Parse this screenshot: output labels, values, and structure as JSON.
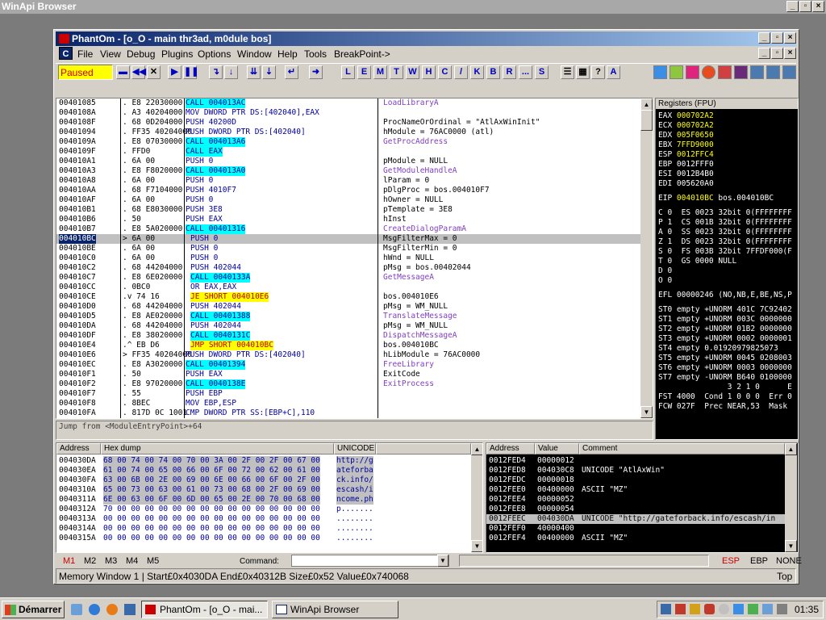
{
  "outer_title": "WinApi Browser",
  "window_title": "PhantOm - [o_O - main thr3ad, m0dule bos]",
  "menu": [
    "File",
    "View",
    "Debug",
    "Plugins",
    "Options",
    "Window",
    "Help",
    "Tools",
    "BreakPoint->"
  ],
  "menu_c": "C",
  "status_paused": "Paused",
  "tool_letters": [
    "L",
    "E",
    "M",
    "T",
    "W",
    "H",
    "C",
    "/",
    "K",
    "B",
    "R",
    "...",
    "S"
  ],
  "tool_help": "?",
  "disasm": [
    [
      "00401085",
      ". E8 22030000",
      "CALL 004013AC",
      "LoadLibraryA"
    ],
    [
      "0040108A",
      ". A3 40204000",
      "MOV DWORD PTR DS:[402040],EAX",
      ""
    ],
    [
      "0040108F",
      ". 68 0D204000",
      "PUSH 40200D",
      "ProcNameOrOrdinal = \"AtlAxWinInit\""
    ],
    [
      "00401094",
      ". FF35 40204000",
      "PUSH DWORD PTR DS:[402040]",
      "hModule = 76AC0000 (atl)"
    ],
    [
      "0040109A",
      ". E8 07030000",
      "CALL 004013A6",
      "GetProcAddress"
    ],
    [
      "0040109F",
      ". FFD0",
      "CALL EAX",
      ""
    ],
    [
      "004010A1",
      ". 6A 00",
      "PUSH 0",
      "pModule = NULL"
    ],
    [
      "004010A3",
      ". E8 F8020000",
      "CALL 004013A0",
      "GetModuleHandleA"
    ],
    [
      "004010A8",
      ". 6A 00",
      "PUSH 0",
      "lParam = 0"
    ],
    [
      "004010AA",
      ". 68 F7104000",
      "PUSH 4010F7",
      "pDlgProc = bos.004010F7"
    ],
    [
      "004010AF",
      ". 6A 00",
      "PUSH 0",
      "hOwner = NULL"
    ],
    [
      "004010B1",
      ". 68 E8030000",
      "PUSH 3E8",
      "pTemplate = 3E8"
    ],
    [
      "004010B6",
      ". 50",
      "PUSH EAX",
      "hInst"
    ],
    [
      "004010B7",
      ". E8 5A020000",
      "CALL 00401316",
      "CreateDialogParamA"
    ],
    [
      "004010BC",
      "> 6A 00",
      "PUSH 0",
      "MsgFilterMax = 0"
    ],
    [
      "004010BE",
      ". 6A 00",
      "PUSH 0",
      "MsgFilterMin = 0"
    ],
    [
      "004010C0",
      ". 6A 00",
      "PUSH 0",
      "hWnd = NULL"
    ],
    [
      "004010C2",
      ". 68 44204000",
      "PUSH 402044",
      "pMsg = bos.00402044"
    ],
    [
      "004010C7",
      ". E8 6E020000",
      "CALL 0040133A",
      "GetMessageA"
    ],
    [
      "004010CC",
      ". 0BC0",
      "OR EAX,EAX",
      ""
    ],
    [
      "004010CE",
      ".v 74 16",
      "JE SHORT 004010E6",
      "bos.004010E6"
    ],
    [
      "004010D0",
      ". 68 44204000",
      "PUSH 402044",
      "pMsg = WM_NULL"
    ],
    [
      "004010D5",
      ". E8 AE020000",
      "CALL 00401388",
      "TranslateMessage"
    ],
    [
      "004010DA",
      ". 68 44204000",
      "PUSH 402044",
      "pMsg = WM_NULL"
    ],
    [
      "004010DF",
      ". E8 38020000",
      "CALL 0040131C",
      "DispatchMessageA"
    ],
    [
      "004010E4",
      ".^ EB D6",
      "JMP SHORT 004010BC",
      "bos.004010BC"
    ],
    [
      "004010E6",
      "> FF35 40204000",
      "PUSH DWORD PTR DS:[402040]",
      "hLibModule = 76AC0000"
    ],
    [
      "004010EC",
      ". E8 A3020000",
      "CALL 00401394",
      "FreeLibrary"
    ],
    [
      "004010F1",
      ". 50",
      "PUSH EAX",
      "ExitCode"
    ],
    [
      "004010F2",
      ". E8 97020000",
      "CALL 0040138E",
      "ExitProcess"
    ],
    [
      "004010F7",
      ". 55",
      "PUSH EBP",
      ""
    ],
    [
      "004010F8",
      ". 8BEC",
      "MOV EBP,ESP",
      ""
    ],
    [
      "004010FA",
      ". 817D 0C 1001",
      "CMP DWORD PTR SS:[EBP+C],110",
      ""
    ]
  ],
  "info_line": "Jump from <ModuleEntryPoint>+64",
  "registers_header": "Registers (FPU)",
  "registers": [
    [
      "EAX",
      "000702A2",
      ""
    ],
    [
      "ECX",
      "000702A2",
      ""
    ],
    [
      "EDX",
      "005F0650",
      ""
    ],
    [
      "EBX",
      "7FFD9000",
      ""
    ],
    [
      "ESP",
      "0012FFC4",
      ""
    ],
    [
      "EBP",
      "0012FFF0",
      ""
    ],
    [
      "ESI",
      "0012B4B0",
      ""
    ],
    [
      "EDI",
      "005620A0",
      ""
    ],
    [
      "",
      "",
      " "
    ],
    [
      "EIP",
      "004010BC",
      "bos.004010BC"
    ]
  ],
  "flags": [
    "C 0  ES 0023 32bit 0(FFFFFFFF",
    "P 1  CS 001B 32bit 0(FFFFFFFF",
    "A 0  SS 0023 32bit 0(FFFFFFFF",
    "Z 1  DS 0023 32bit 0(FFFFFFFF",
    "S 0  FS 003B 32bit 7FFDF000(F",
    "T 0  GS 0000 NULL",
    "D 0",
    "O 0"
  ],
  "efl": "EFL 00000246 (NO,NB,E,BE,NS,P",
  "fpu": [
    "ST0 empty +UNORM 401C 7C92402",
    "ST1 empty +UNORM 003C 0000000",
    "ST2 empty +UNORM 01B2 0000000",
    "ST3 empty +UNORM 0002 0000001",
    "ST4 empty 0.01920979825073",
    "ST5 empty +UNORM 0045 0208003",
    "ST6 empty +UNORM 0003 0000000",
    "ST7 empty -UNORM B640 0100000"
  ],
  "fpu_bits": "               3 2 1 0      E",
  "fst": "FST 4000  Cond 1 0 0 0  Err 0",
  "fcw": "FCW 027F  Prec NEAR,53  Mask",
  "dump_headers": [
    "Address",
    "Hex dump",
    "UNICODE"
  ],
  "dump": [
    [
      "004030DA",
      "68 00 74 00 74 00 70 00 3A 00 2F 00 2F 00 67 00",
      "http://g"
    ],
    [
      "004030EA",
      "61 00 74 00 65 00 66 00 6F 00 72 00 62 00 61 00",
      "ateforba"
    ],
    [
      "004030FA",
      "63 00 6B 00 2E 00 69 00 6E 00 66 00 6F 00 2F 00",
      "ck.info/"
    ],
    [
      "0040310A",
      "65 00 73 00 63 00 61 00 73 00 68 00 2F 00 69 00",
      "escash/i"
    ],
    [
      "0040311A",
      "6E 00 63 00 6F 00 6D 00 65 00 2E 00 70 00 68 00",
      "ncome.ph"
    ],
    [
      "0040312A",
      "70 00 00 00 00 00 00 00 00 00 00 00 00 00 00 00",
      "p......."
    ],
    [
      "0040313A",
      "00 00 00 00 00 00 00 00 00 00 00 00 00 00 00 00",
      "........"
    ],
    [
      "0040314A",
      "00 00 00 00 00 00 00 00 00 00 00 00 00 00 00 00",
      "........"
    ],
    [
      "0040315A",
      "00 00 00 00 00 00 00 00 00 00 00 00 00 00 00 00",
      "........"
    ]
  ],
  "stack_headers": [
    "Address",
    "Value",
    "Comment"
  ],
  "stack": [
    [
      "0012FED4",
      "00000012",
      ""
    ],
    [
      "0012FED8",
      "004030C8",
      "UNICODE \"AtlAxWin\""
    ],
    [
      "0012FEDC",
      "00000018",
      ""
    ],
    [
      "0012FEE0",
      "00400000",
      "ASCII \"MZ\""
    ],
    [
      "0012FEE4",
      "00000052",
      ""
    ],
    [
      "0012FEE8",
      "00000054",
      ""
    ],
    [
      "0012FEEC",
      "004030DA",
      "UNICODE \"http://gateforback.info/escash/in"
    ],
    [
      "0012FEF0",
      "40000400",
      ""
    ],
    [
      "0012FEF4",
      "00400000",
      "ASCII \"MZ\""
    ]
  ],
  "mem_tabs": [
    "M1",
    "M2",
    "M3",
    "M4",
    "M5"
  ],
  "command_label": "Command:",
  "esp_tabs": [
    "ESP",
    "EBP",
    "NONE"
  ],
  "statusbar": "Memory Window 1 | Start£0x4030DA  End£0x40312B  Size£0x52 Value£0x740068",
  "status_top": "Top",
  "taskbar": {
    "start": "Démarrer",
    "task1": "PhantOm - [o_O - mai...",
    "task2": "WinApi Browser",
    "clock": "01:35"
  },
  "colors": {
    "call_bg": "#00ffff",
    "jump_bg": "#ffff00",
    "highlight_yellow": "#ffff00",
    "reg_bg": "#000000"
  }
}
